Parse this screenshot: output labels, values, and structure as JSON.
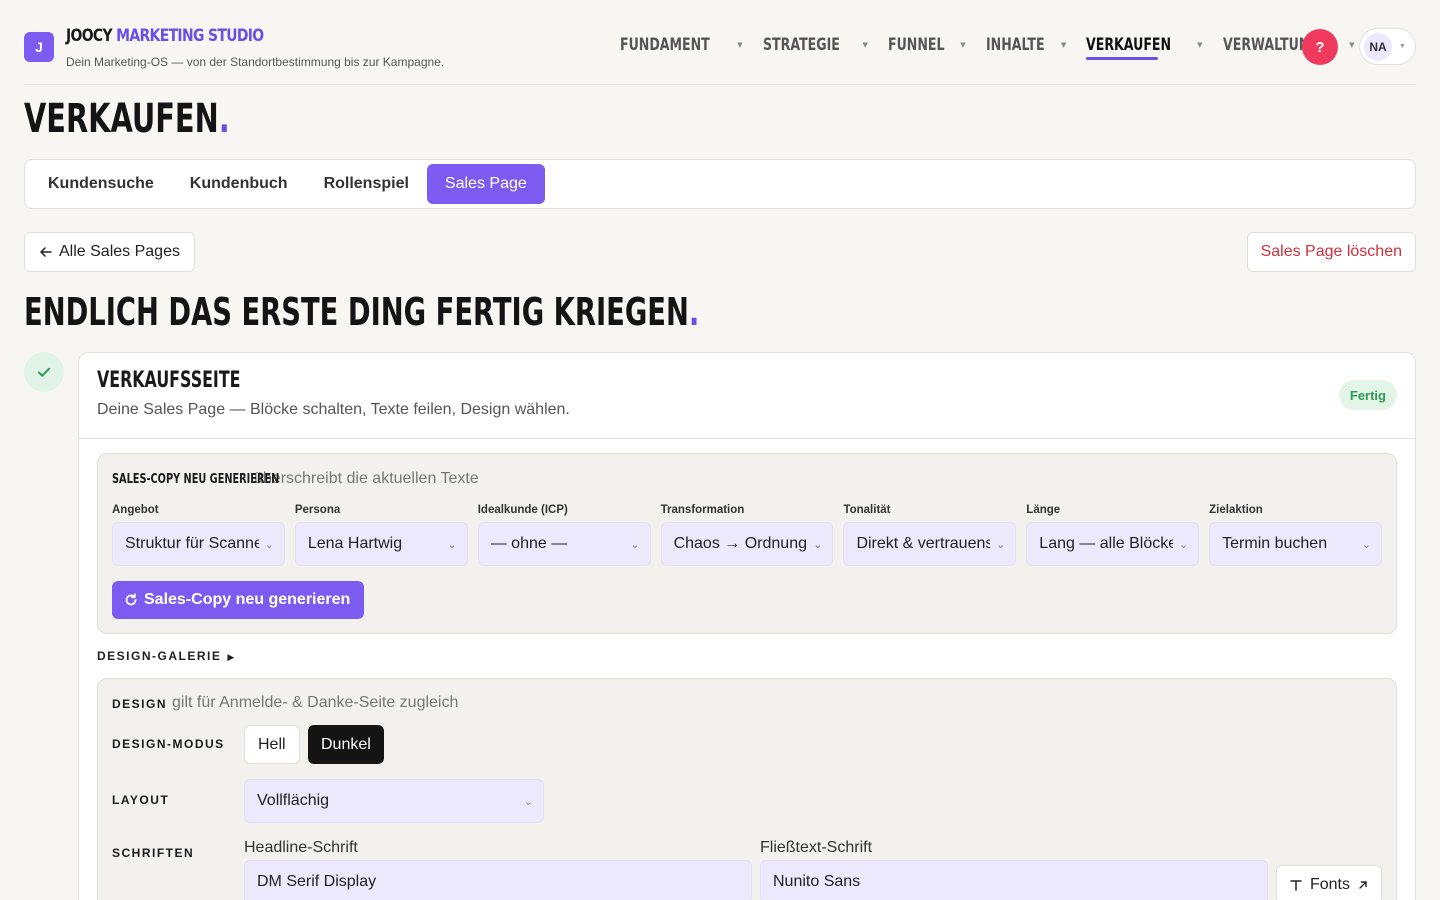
{
  "brand": {
    "logo_letter": "J",
    "name_part1": "JOOCY",
    "name_part2": "MARKETING STUDIO",
    "tagline": "Dein Marketing-OS — von der Standortbestimmung bis zur Kampagne."
  },
  "nav": {
    "items": [
      {
        "label": "FUNDAMENT"
      },
      {
        "label": "STRATEGIE"
      },
      {
        "label": "FUNNEL"
      },
      {
        "label": "INHALTE"
      },
      {
        "label": "VERKAUFEN"
      },
      {
        "label": "VERWALTUNG"
      }
    ],
    "active": "VERKAUFEN"
  },
  "header": {
    "help_label": "?",
    "user_initials": "NA"
  },
  "page": {
    "title": "VERKAUFEN",
    "title_dot": "."
  },
  "tabs": {
    "items": [
      {
        "label": "Kundensuche"
      },
      {
        "label": "Kundenbuch"
      },
      {
        "label": "Rollenspiel"
      },
      {
        "label": "Sales Page"
      }
    ],
    "active": "Sales Page"
  },
  "actions": {
    "back_label": "Alle Sales Pages",
    "delete_label": "Sales Page löschen"
  },
  "headline": {
    "text": "ENDLICH DAS ERSTE DING FERTIG KRIEGEN",
    "dot": "."
  },
  "card": {
    "title": "VERKAUFSSEITE",
    "subtitle": "Deine Sales Page — Blöcke schalten, Texte feilen, Design wählen.",
    "status": "Fertig"
  },
  "regen": {
    "heading": "SALES-COPY NEU GENERIEREN",
    "note": "überschreibt die aktuellen Texte",
    "fields": [
      {
        "label": "Angebot",
        "value": "Struktur für Scanner"
      },
      {
        "label": "Persona",
        "value": "Lena Hartwig"
      },
      {
        "label": "Idealkunde (ICP)",
        "value": "— ohne —"
      },
      {
        "label": "Transformation",
        "value": "Chaos → Ordnung"
      },
      {
        "label": "Tonalität",
        "value": "Direkt & vertrauensvoll"
      },
      {
        "label": "Länge",
        "value": "Lang — alle Blöcke"
      },
      {
        "label": "Zielaktion",
        "value": "Termin buchen"
      }
    ],
    "button_label": "Sales-Copy neu generieren"
  },
  "gallery": {
    "label": "DESIGN-GALERIE"
  },
  "design": {
    "heading": "DESIGN",
    "note": "gilt für Anmelde- & Danke-Seite zugleich",
    "mode_label": "DESIGN-MODUS",
    "mode_options": [
      "Hell",
      "Dunkel"
    ],
    "mode_selected": "Dunkel",
    "layout_label": "LAYOUT",
    "layout_value": "Vollflächig",
    "fonts_label": "SCHRIFTEN",
    "headline_font_label": "Headline-Schrift",
    "headline_font_value": "DM Serif Display",
    "body_font_label": "Fließtext-Schrift",
    "body_font_value": "Nunito Sans",
    "fonts_button_label": "Fonts"
  },
  "colors": {
    "accent": "#7c5cf0",
    "danger": "#d0303a",
    "success": "#2f9a55",
    "help": "#ef3a5d"
  }
}
